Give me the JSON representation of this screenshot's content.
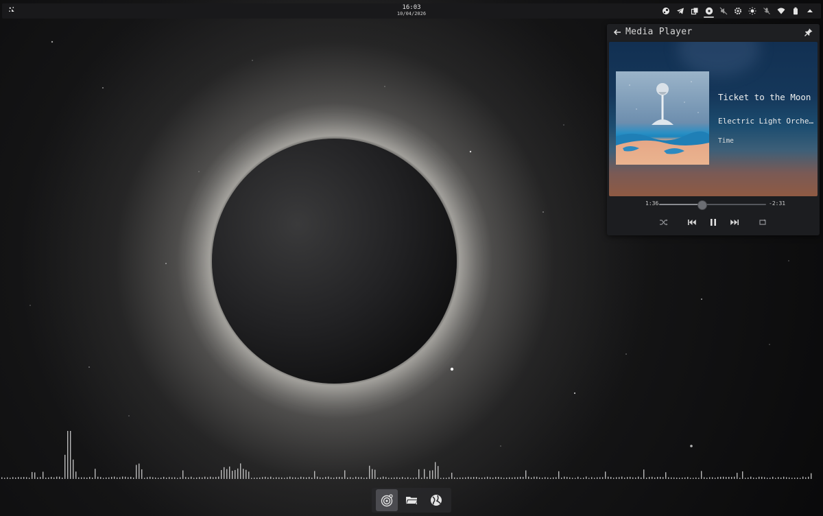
{
  "topbar": {
    "launcher_icon": "launcher-icon",
    "clock": {
      "time": "16:03",
      "date": "10/04/2026"
    },
    "tray": [
      {
        "name": "steam-icon"
      },
      {
        "name": "telegram-icon"
      },
      {
        "name": "window-switcher-icon"
      },
      {
        "name": "media-player-icon",
        "active": true
      },
      {
        "name": "speaker-muted-icon"
      },
      {
        "name": "settings-icon"
      },
      {
        "name": "brightness-icon"
      },
      {
        "name": "microphone-muted-icon"
      },
      {
        "name": "wifi-icon"
      },
      {
        "name": "battery-icon"
      },
      {
        "name": "tray-expand-icon"
      }
    ]
  },
  "media_player": {
    "title": "Media Player",
    "track": {
      "title": "Ticket to the Moon",
      "artist": "Electric Light Orchestra",
      "album": "Time"
    },
    "elapsed": "1:36",
    "remaining": "-2:31",
    "progress": 0.4,
    "state": "playing"
  },
  "dock": {
    "items": [
      {
        "name": "dock-radar-icon",
        "active": true
      },
      {
        "name": "dock-folder-icon",
        "active": false
      },
      {
        "name": "dock-globe-icon",
        "active": false
      }
    ]
  },
  "colors": {
    "topbar": "#19191b",
    "player_bg": "#1c1d20",
    "accent": "#d6d6d6"
  }
}
